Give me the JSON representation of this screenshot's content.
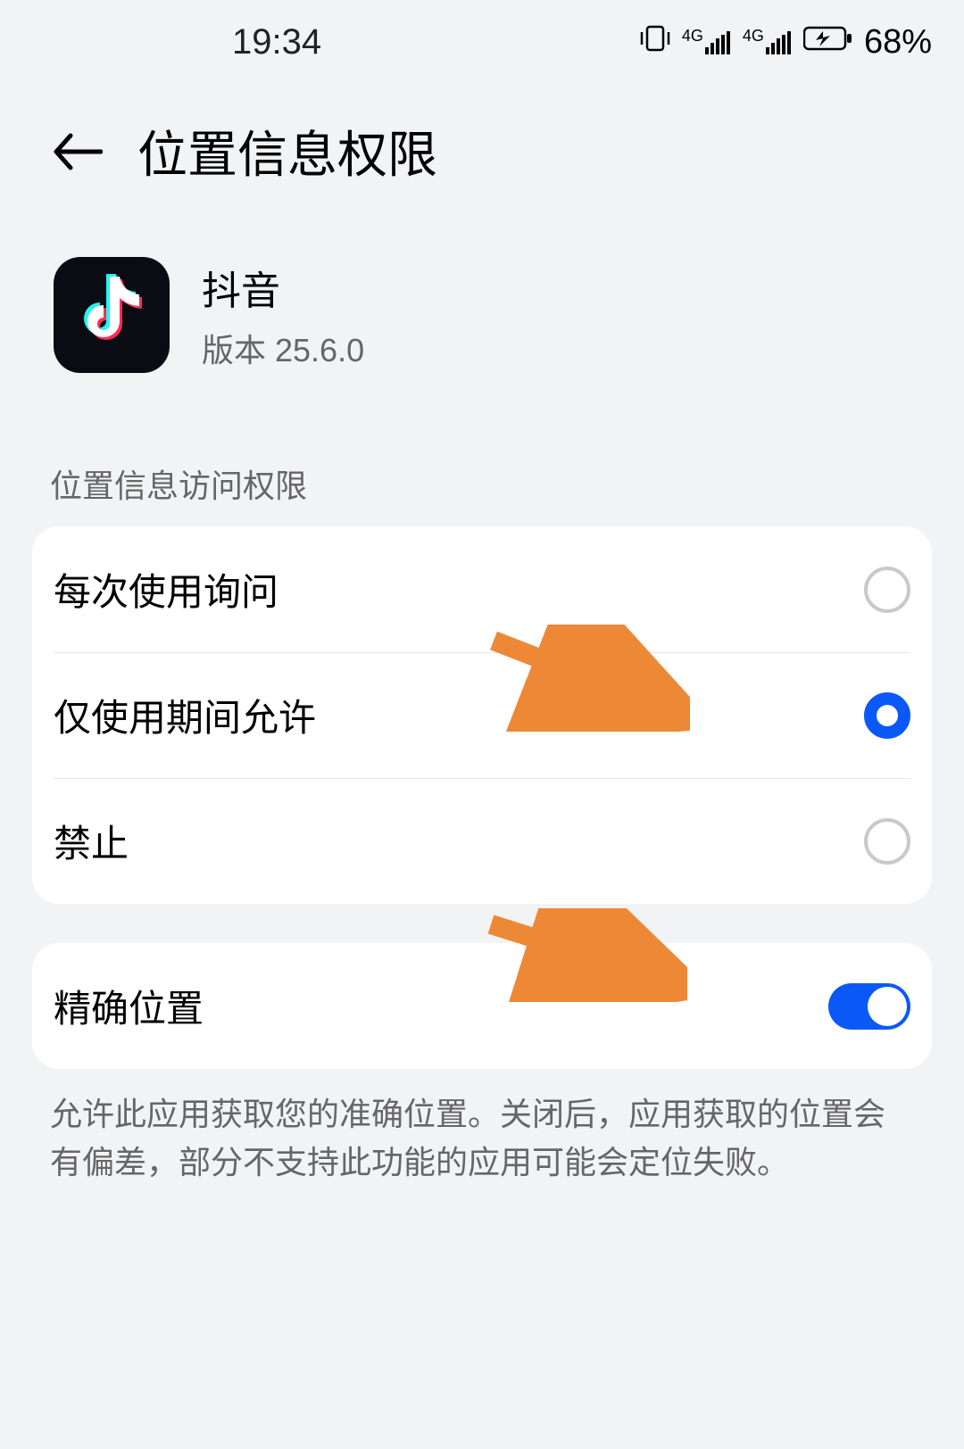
{
  "status": {
    "time": "19:34",
    "network1": "4G",
    "network2": "4G",
    "battery_pct": "68%"
  },
  "header": {
    "title": "位置信息权限"
  },
  "app": {
    "name": "抖音",
    "version_label": "版本 25.6.0"
  },
  "section_label": "位置信息访问权限",
  "options": [
    {
      "label": "每次使用询问",
      "selected": false
    },
    {
      "label": "仅使用期间允许",
      "selected": true
    },
    {
      "label": "禁止",
      "selected": false
    }
  ],
  "precise": {
    "label": "精确位置",
    "enabled": true
  },
  "footer_note": "允许此应用获取您的准确位置。关闭后，应用获取的位置会有偏差，部分不支持此功能的应用可能会定位失败。",
  "colors": {
    "accent": "#0a59f7",
    "arrow": "#ed8936"
  }
}
